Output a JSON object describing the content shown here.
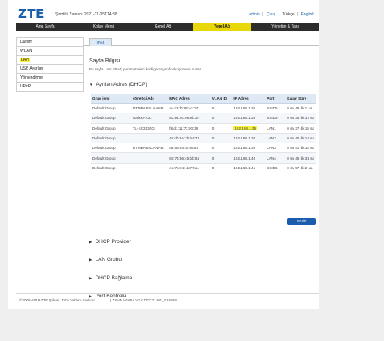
{
  "header": {
    "logo": "ZTE",
    "clock": "Şimdiki Zaman: 2021-11-05T14:38",
    "links": {
      "admin": "admin",
      "logout": "Çıkış",
      "lang_tr": "Türkçe",
      "sep": "|",
      "lang_en": "English"
    }
  },
  "nav": {
    "items": [
      {
        "label": "Ana Sayfa"
      },
      {
        "label": "Kolay Menü"
      },
      {
        "label": "Genel Ağ"
      },
      {
        "label": "Yerel Ağ",
        "active": true
      },
      {
        "label": "Yönetim & Tanı"
      }
    ]
  },
  "sidebar": {
    "items": [
      {
        "label": "Durum"
      },
      {
        "label": "WLAN"
      },
      {
        "label": "LAN",
        "highlighted": true
      },
      {
        "label": "USB Ayarları"
      },
      {
        "label": "Yönlendirme"
      },
      {
        "label": "UPnP"
      }
    ]
  },
  "tabs": [
    {
      "label": "IPv4"
    }
  ],
  "main": {
    "title": "Sayfa Bilgisi",
    "description": "Bu sayfa LAN (IPv4) parametreleri konfigürasyon fonksiyonunu sunar.",
    "section_expanded": "Ayrılan Adres (DHCP)",
    "collapsed_sections": [
      "DHCP Provider",
      "LAN Grubu",
      "DHCP Bağlama",
      "Port Kontrolü"
    ],
    "refresh_button": "Yenile"
  },
  "table": {
    "headers": [
      "Grup ismi",
      "yönetici Adı",
      "MAC Adres",
      "VLAN ID",
      "IP Adres",
      "Port",
      "Kalan Süre"
    ],
    "rows": [
      [
        "Default Group",
        "DTMBARSLANNB",
        "a4:c3:f0:95:cc:07",
        "0",
        "192.168.1.36",
        "SSID5",
        "0 sa 48 dk 1 sa"
      ],
      [
        "Default Group",
        "Galaxy-A31",
        "82:e1:5c:09:9b:3c",
        "0",
        "192.168.1.33",
        "SSID5",
        "0 sa 35 dk 37 sa"
      ],
      [
        "Default Group",
        "TL-SC3130G",
        "f8:d1:11:7c:00:d9",
        "0",
        "192.168.1.35",
        "LAN1",
        "0 sa 37 dk 18 sa"
      ],
      [
        "Default Group",
        "",
        "4c:d0:8a:2b:b4:73",
        "0",
        "192.168.1.38",
        "LAN2",
        "0 sa 40 dk 14 sa"
      ],
      [
        "Default Group",
        "DTMBARSLANNB",
        "a8:6a:64:f0:66:51",
        "0",
        "192.168.1.39",
        "LAN3",
        "0 sa 41 dk 15 sa"
      ],
      [
        "Default Group",
        "",
        "60:74:b6:c5:bb:84",
        "0",
        "192.168.1.40",
        "LAN4",
        "0 sa 45 dk 31 sa"
      ],
      [
        "Default Group",
        "",
        "ea:7a:94:11:77:a1",
        "0",
        "192.168.1.41",
        "SSID5",
        "0 sa 57 dk 2 sa"
      ]
    ],
    "highlighted_ip": "192.168.1.35"
  },
  "footer": {
    "copyright": "©2008-2019 ZTE Şirketi. Tüm hakları Saklıdır",
    "model": "|  ZXHN H168A V2.0 DGT7.1N1_210826"
  },
  "colors": {
    "accent": "#1a5dad",
    "active_nav": "#e8d80a",
    "highlight": "#f7f23a",
    "nav_bg": "#2c2c2c"
  }
}
